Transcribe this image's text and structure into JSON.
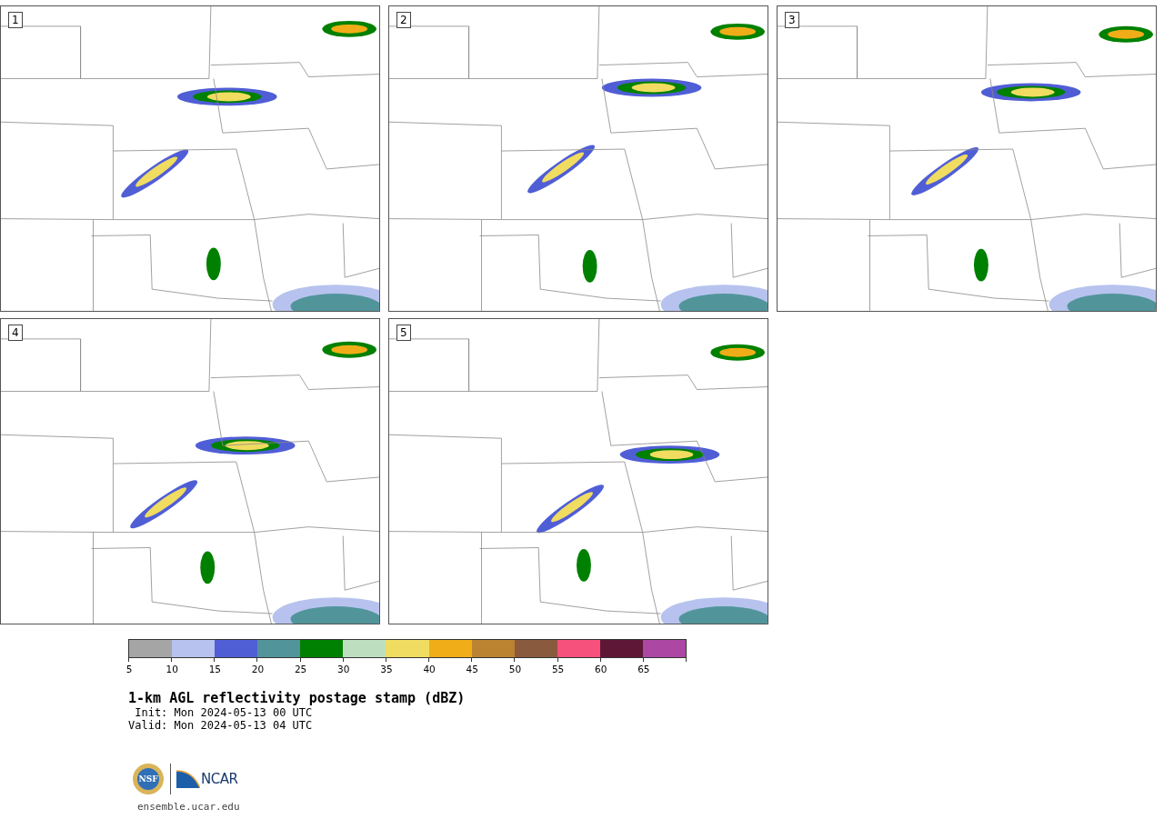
{
  "panels": [
    {
      "label": "1"
    },
    {
      "label": "2"
    },
    {
      "label": "3"
    },
    {
      "label": "4"
    },
    {
      "label": "5"
    }
  ],
  "colorbar": {
    "bins": [
      {
        "tick": "5",
        "color": "#a5a5a5"
      },
      {
        "tick": "10",
        "color": "#b7c3ee"
      },
      {
        "tick": "15",
        "color": "#505ed6"
      },
      {
        "tick": "20",
        "color": "#51959b"
      },
      {
        "tick": "25",
        "color": "#008000"
      },
      {
        "tick": "30",
        "color": "#bedfbf"
      },
      {
        "tick": "35",
        "color": "#f0dc60"
      },
      {
        "tick": "40",
        "color": "#f0ad18"
      },
      {
        "tick": "45",
        "color": "#bb8230"
      },
      {
        "tick": "50",
        "color": "#8a5a3e"
      },
      {
        "tick": "55",
        "color": "#f6507c"
      },
      {
        "tick": "60",
        "color": "#5f1736"
      },
      {
        "tick": "65",
        "color": "#ac48a4"
      }
    ]
  },
  "title": "1-km AGL reflectivity postage stamp (dBZ)",
  "init": " Init: Mon 2024-05-13 00 UTC",
  "valid": "Valid: Mon 2024-05-13 04 UTC",
  "logos": {
    "nsf": "NSF",
    "ncar": "NCAR"
  },
  "site": "ensemble.ucar.edu"
}
